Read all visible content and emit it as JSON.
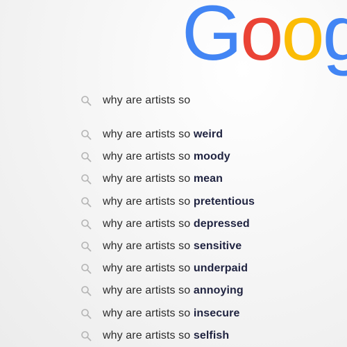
{
  "logo": {
    "letters": [
      {
        "char": "G",
        "color": "#4285F4"
      },
      {
        "char": "o",
        "color": "#EA4335"
      },
      {
        "char": "o",
        "color": "#FBBC05"
      },
      {
        "char": "g",
        "color": "#4285F4"
      }
    ]
  },
  "search": {
    "query": "why are artists so",
    "icon": "search-icon"
  },
  "suggestions": [
    {
      "prefix": "why are artists so ",
      "completion": "weird"
    },
    {
      "prefix": "why are artists so ",
      "completion": "moody"
    },
    {
      "prefix": "why are artists so ",
      "completion": "mean"
    },
    {
      "prefix": "why are artists so ",
      "completion": "pretentious"
    },
    {
      "prefix": "why are artists so ",
      "completion": "depressed"
    },
    {
      "prefix": "why are artists so ",
      "completion": "sensitive"
    },
    {
      "prefix": "why are artists so ",
      "completion": "underpaid"
    },
    {
      "prefix": "why are artists so ",
      "completion": "annoying"
    },
    {
      "prefix": "why are artists so ",
      "completion": "insecure"
    },
    {
      "prefix": "why are artists so ",
      "completion": "selfish"
    }
  ],
  "colors": {
    "icon": "#b4b4b4",
    "text": "#2b2b2b",
    "bold": "#1f2340"
  }
}
